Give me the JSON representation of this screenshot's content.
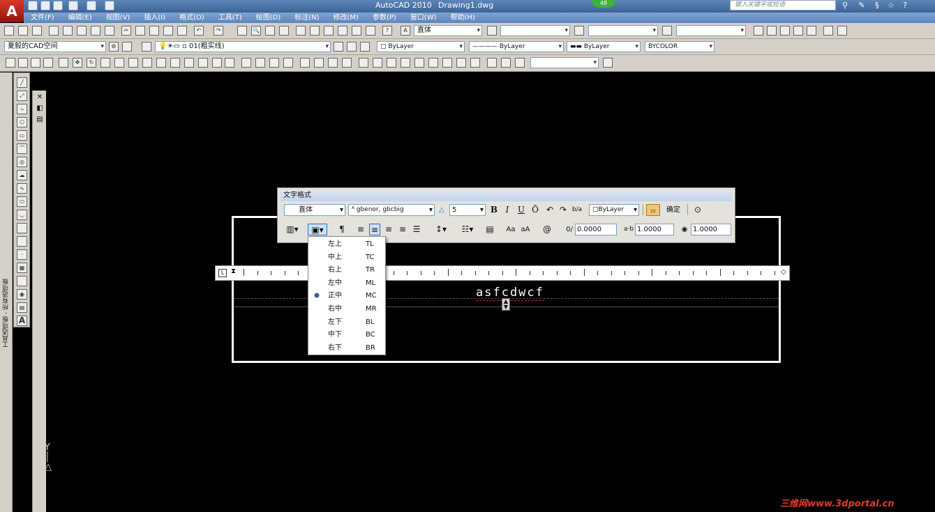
{
  "title": {
    "app": "AutoCAD 2010",
    "document": "Drawing1.dwg",
    "search_placeholder": "键入关键字或短语",
    "badge": "48"
  },
  "menus": [
    "文件(F)",
    "编辑(E)",
    "视图(V)",
    "插入(I)",
    "格式(O)",
    "工具(T)",
    "绘图(D)",
    "标注(N)",
    "修改(M)",
    "参数(P)",
    "窗口(W)",
    "帮助(H)"
  ],
  "toolbar1": {
    "text_style": "直体"
  },
  "toolbar2": {
    "workspace": "夏毅的CAD空间",
    "layer": "01(粗实线)",
    "color": "ByLayer",
    "linetype": "ByLayer",
    "lineweight": "ByLayer",
    "plotstyle": "BYCOLOR"
  },
  "side_panel": {
    "label": "工具选项板 - 所有选项板"
  },
  "text_format": {
    "title": "文字格式",
    "style": "直体",
    "font": "gbenor, gbcbig",
    "height": "5",
    "color": "ByLayer",
    "ok": "确定",
    "bold": "B",
    "italic": "I",
    "underline": "U",
    "overline": "Ō",
    "case_upper": "Aa",
    "case_lower": "aA",
    "symbol": "@",
    "oblique": "0.0000",
    "tracking": "1.0000",
    "width": "1.0000"
  },
  "justify_menu": {
    "items": [
      {
        "cn": "左上",
        "code": "TL"
      },
      {
        "cn": "中上",
        "code": "TC"
      },
      {
        "cn": "右上",
        "code": "TR"
      },
      {
        "cn": "左中",
        "code": "ML"
      },
      {
        "cn": "正中",
        "code": "MC"
      },
      {
        "cn": "右中",
        "code": "MR"
      },
      {
        "cn": "左下",
        "code": "BL"
      },
      {
        "cn": "中下",
        "code": "BC"
      },
      {
        "cn": "右下",
        "code": "BR"
      }
    ],
    "selected_code": "MC"
  },
  "canvas": {
    "text": "asfcdwcf"
  },
  "watermark": "三维网www.3dportal.cn"
}
